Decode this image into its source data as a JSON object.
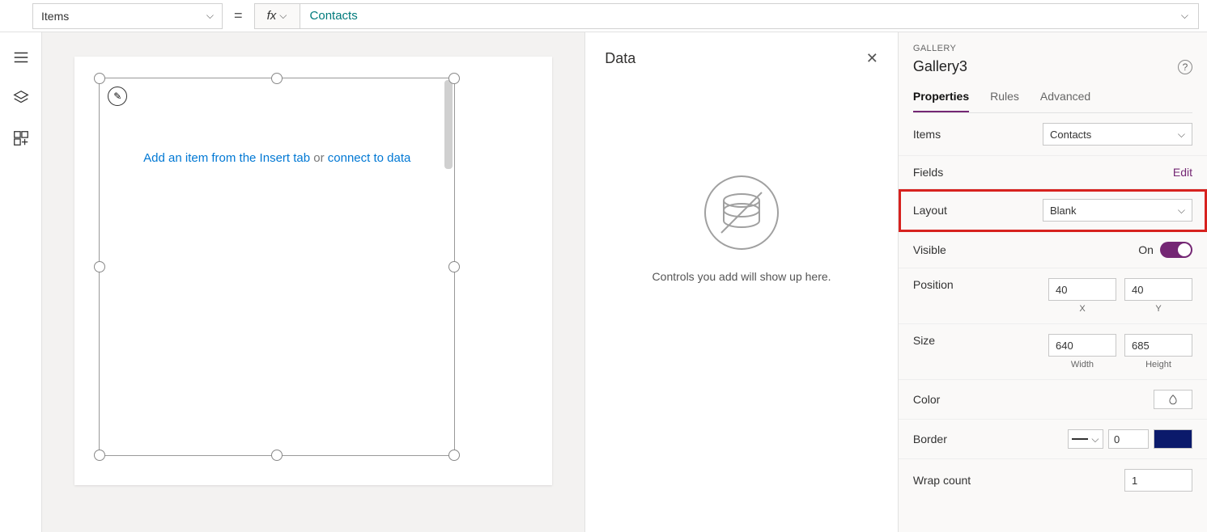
{
  "formulaBar": {
    "property": "Items",
    "fxLabel": "fx",
    "value": "Contacts"
  },
  "canvas": {
    "hintPart1": "Add an item from the Insert tab",
    "hintOr": "or",
    "hintPart2": "connect to data"
  },
  "dataPanel": {
    "title": "Data",
    "emptyText": "Controls you add will show up here."
  },
  "rightPanel": {
    "typeLabel": "GALLERY",
    "name": "Gallery3",
    "tabs": {
      "properties": "Properties",
      "rules": "Rules",
      "advanced": "Advanced"
    },
    "items": {
      "label": "Items",
      "value": "Contacts"
    },
    "fields": {
      "label": "Fields",
      "edit": "Edit"
    },
    "layout": {
      "label": "Layout",
      "value": "Blank"
    },
    "visible": {
      "label": "Visible",
      "state": "On"
    },
    "position": {
      "label": "Position",
      "x": "40",
      "y": "40",
      "xLabel": "X",
      "yLabel": "Y"
    },
    "size": {
      "label": "Size",
      "w": "640",
      "h": "685",
      "wLabel": "Width",
      "hLabel": "Height"
    },
    "color": {
      "label": "Color"
    },
    "border": {
      "label": "Border",
      "width": "0"
    },
    "wrap": {
      "label": "Wrap count",
      "value": "1"
    }
  }
}
